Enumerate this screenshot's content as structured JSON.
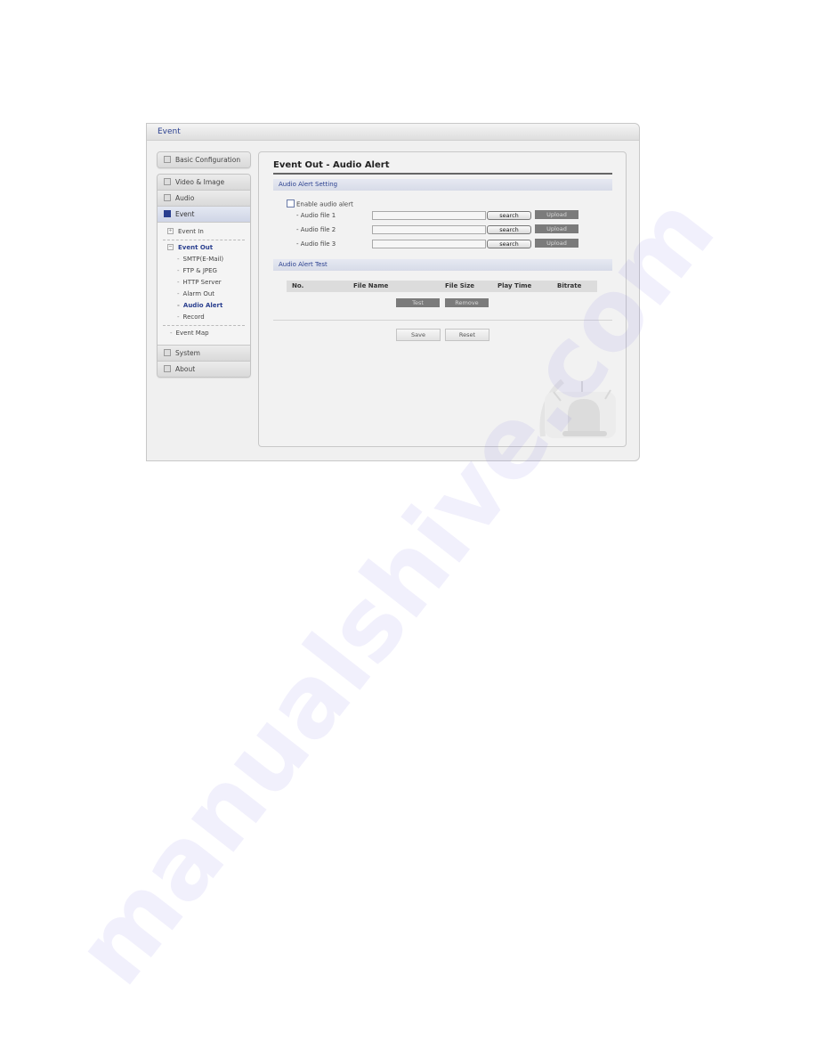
{
  "window": {
    "title": "Event"
  },
  "sidebar": {
    "groups": [
      {
        "items": [
          {
            "label": "Basic Configuration"
          }
        ]
      },
      {
        "items": [
          {
            "label": "Video & Image"
          },
          {
            "label": "Audio"
          },
          {
            "label": "Event",
            "active": true
          }
        ],
        "event_subitems": {
          "event_in": "Event In",
          "event_out": "Event Out",
          "event_out_children": [
            "SMTP(E-Mail)",
            "FTP & JPEG",
            "HTTP Server",
            "Alarm Out",
            "Audio Alert",
            "Record"
          ],
          "active_child": "Audio Alert",
          "event_map": "Event Map"
        },
        "after_items": [
          {
            "label": "System"
          },
          {
            "label": "About"
          }
        ]
      }
    ]
  },
  "main": {
    "page_title": "Event Out - Audio Alert",
    "setting_section": {
      "title": "Audio Alert Setting",
      "enable_label": "Enable audio alert",
      "enable_checked": false,
      "files": [
        {
          "label": "- Audio file 1",
          "value": "",
          "search_label": "search",
          "upload_label": "Upload"
        },
        {
          "label": "- Audio file 2",
          "value": "",
          "search_label": "search",
          "upload_label": "Upload"
        },
        {
          "label": "- Audio file 3",
          "value": "",
          "search_label": "search",
          "upload_label": "Upload"
        }
      ]
    },
    "test_section": {
      "title": "Audio Alert Test",
      "columns": [
        "No.",
        "File Name",
        "File Size",
        "Play Time",
        "Bitrate"
      ],
      "rows": [],
      "test_label": "Test",
      "remove_label": "Remove"
    },
    "save_label": "Save",
    "reset_label": "Reset"
  },
  "watermark": "manualshive.com"
}
